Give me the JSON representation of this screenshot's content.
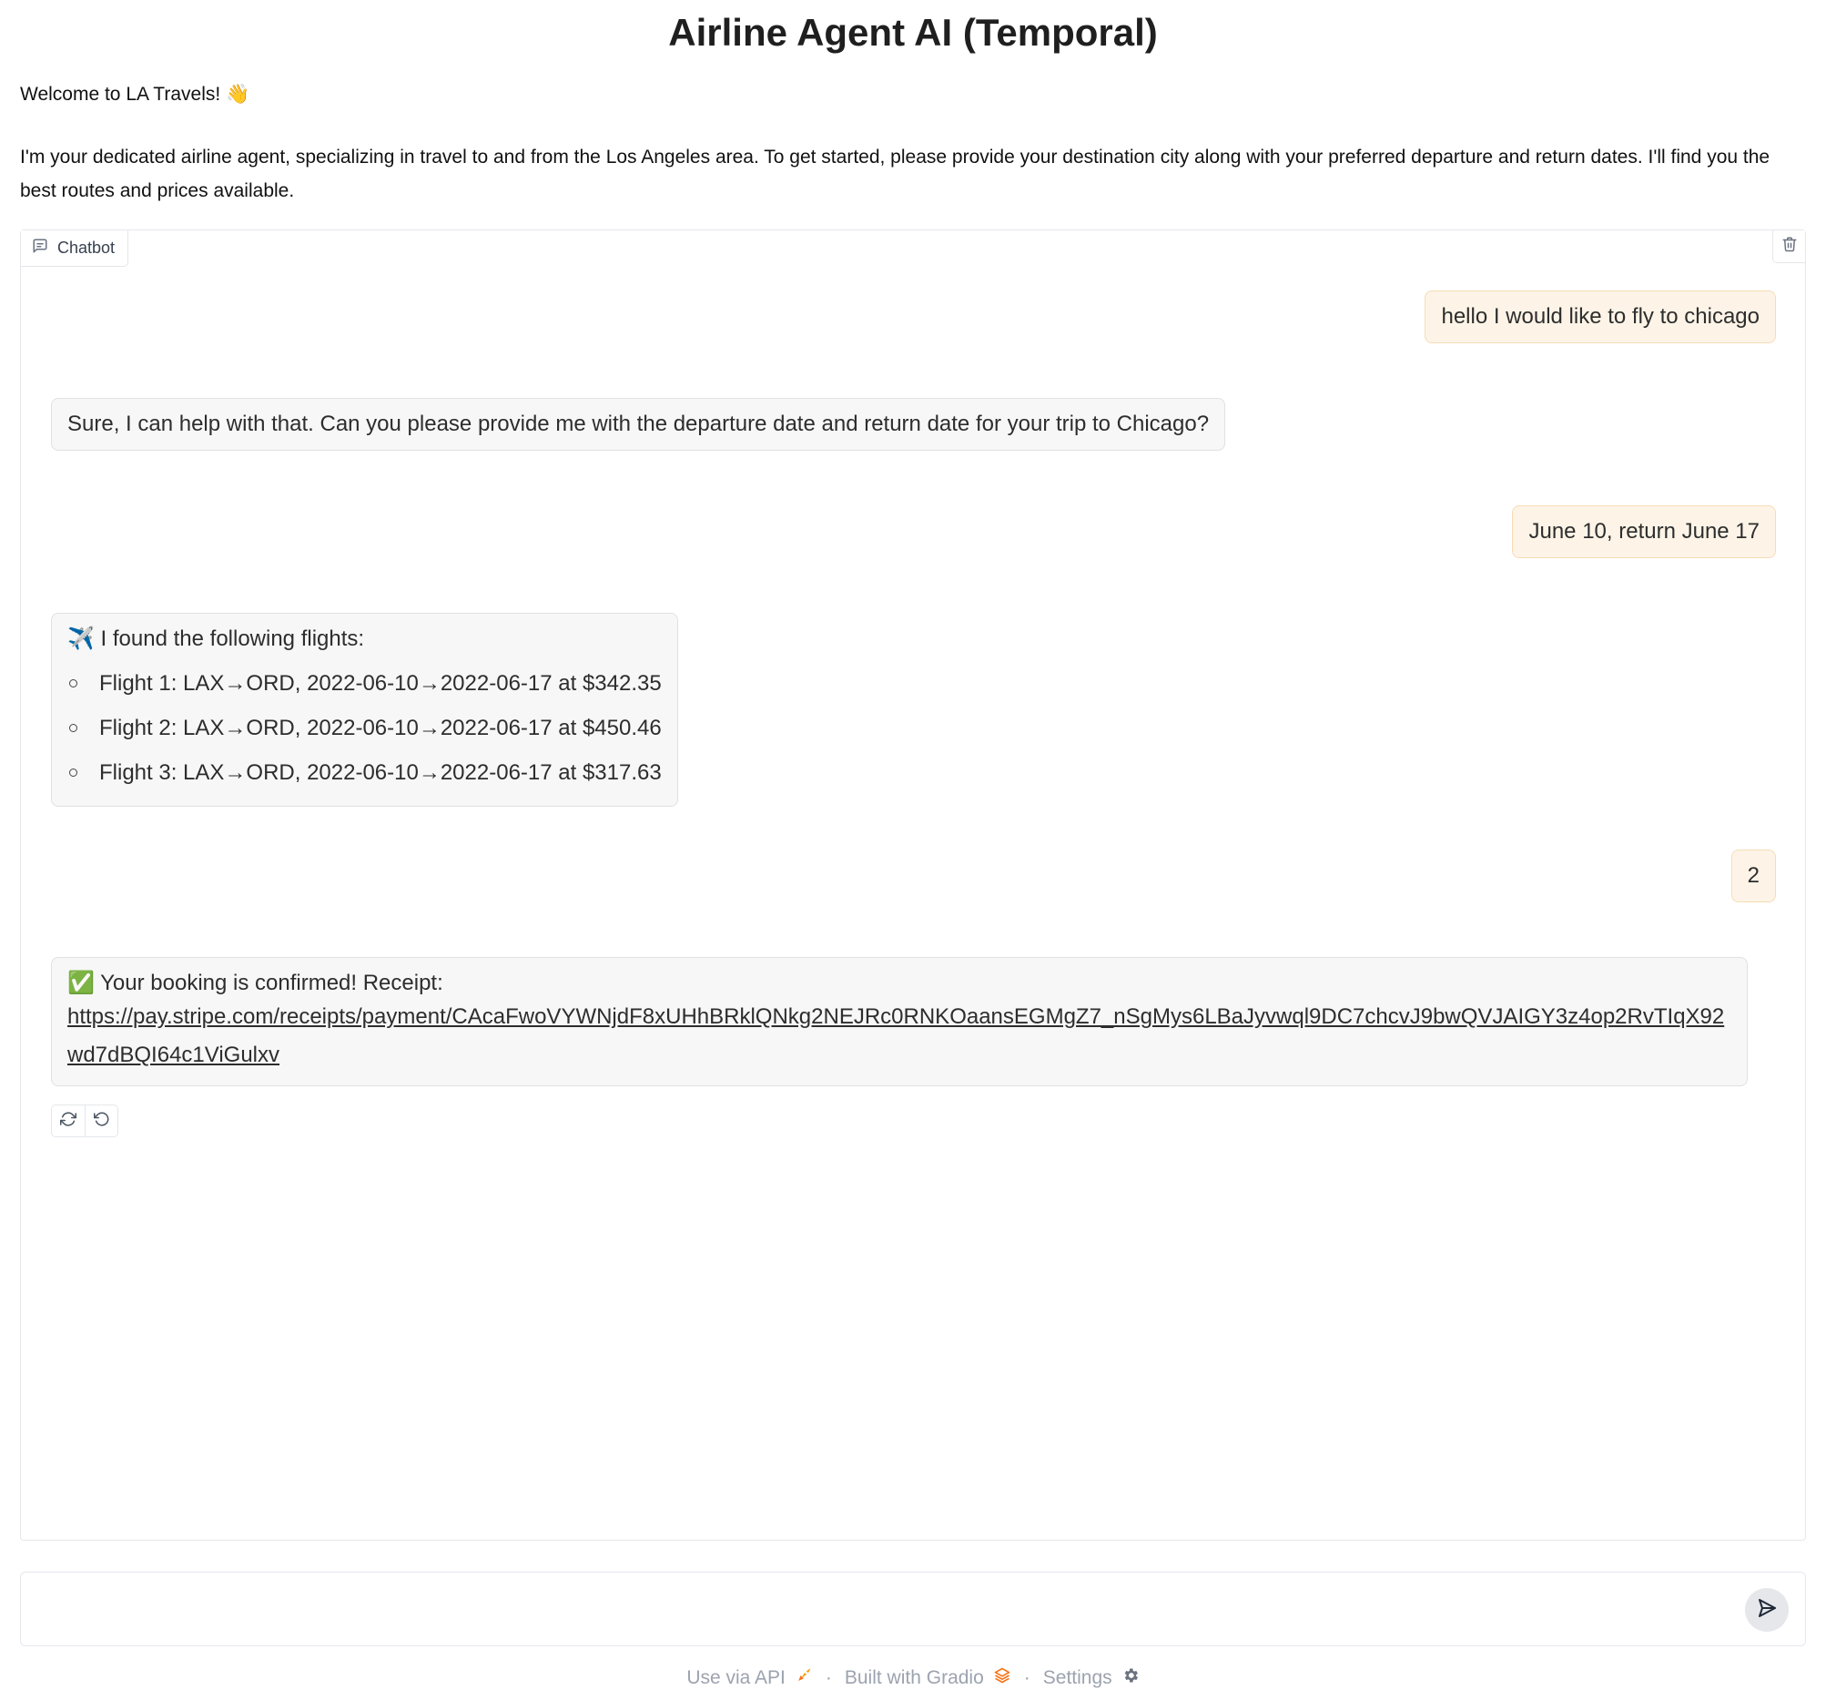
{
  "page": {
    "title": "Airline Agent AI (Temporal)",
    "welcome": "Welcome to LA Travels! 👋",
    "intro": "I'm your dedicated airline agent, specializing in travel to and from the Los Angeles area. To get started, please provide your destination city along with your preferred departure and return dates. I'll find you the best routes and prices available."
  },
  "chatbot": {
    "label": "Chatbot",
    "messages": [
      {
        "role": "user",
        "text": "hello I would like to fly to chicago"
      },
      {
        "role": "bot",
        "text": "Sure, I can help with that. Can you please provide me with the departure date and return date for your trip to Chicago?"
      },
      {
        "role": "user",
        "text": "June 10, return June 17"
      },
      {
        "role": "bot",
        "intro": "✈️ I found the following flights:",
        "flights": [
          "Flight 1: LAX→ORD, 2022-06-10→2022-06-17 at $342.35",
          "Flight 2: LAX→ORD, 2022-06-10→2022-06-17 at $450.46",
          "Flight 3: LAX→ORD, 2022-06-10→2022-06-17 at $317.63"
        ]
      },
      {
        "role": "user",
        "text": "2"
      },
      {
        "role": "bot",
        "intro": "✅ Your booking is confirmed! Receipt:",
        "link": "https://pay.stripe.com/receipts/payment/CAcaFwoVYWNjdF8xUHhBRklQNkg2NEJRc0RNKOaansEGMgZ7_nSgMys6LBaJyvwql9DC7chcvJ9bwQVJAIGY3z4op2RvTIqX92wd7dBQI64c1ViGulxv"
      }
    ]
  },
  "input": {
    "placeholder": ""
  },
  "footer": {
    "api": "Use via API",
    "built": "Built with Gradio",
    "settings": "Settings",
    "separator": "·"
  },
  "colors": {
    "user_bubble": "#fdf4e7",
    "bot_bubble": "#f7f7f7",
    "gradio_orange": "#f97316"
  }
}
